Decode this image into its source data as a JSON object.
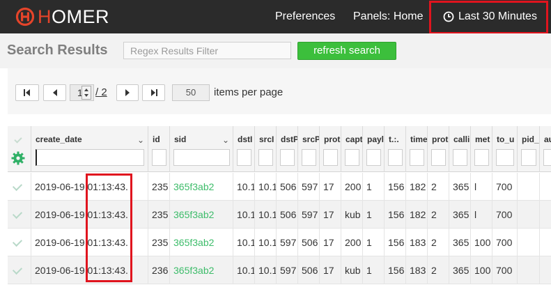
{
  "navbar": {
    "logo_h": "H",
    "logo_rest": "OMER",
    "preferences": "Preferences",
    "panels": "Panels: Home",
    "time_range": "Last 30 Minutes"
  },
  "search": {
    "title": "Search Results",
    "filter_placeholder": "Regex Results Filter",
    "refresh_label": "refresh search"
  },
  "pager": {
    "current_page": "1",
    "total_pages": "/ 2",
    "per_page": "50",
    "per_page_label": "items per page"
  },
  "grid": {
    "columns": [
      "create_date",
      "id",
      "sid",
      "dstIp",
      "srcIp",
      "dstPort",
      "srcPort",
      "protocol",
      "capture",
      "payload",
      "type",
      "time",
      "proto",
      "callid",
      "method",
      "to_user",
      "pid_user",
      "auth"
    ],
    "column_display": [
      "create_date",
      "id",
      "sid",
      "dstI",
      "srcI",
      "dstP",
      "srcP",
      "prot",
      "capt",
      "payl",
      "t.:.",
      "time",
      "prot",
      "calli",
      "met",
      "to_u",
      "pid_",
      "auth"
    ],
    "rows": [
      [
        "2019-06-19 01:13:43.",
        "235",
        "365f3ab2",
        "10.1",
        "10.1",
        "506",
        "597",
        "17",
        "200",
        "1",
        "156",
        "182",
        "2",
        "365",
        "l",
        "700",
        "",
        ""
      ],
      [
        "2019-06-19 01:13:43.",
        "235",
        "365f3ab2",
        "10.1",
        "10.1",
        "506",
        "597",
        "17",
        "kub",
        "1",
        "156",
        "182",
        "2",
        "365",
        "l",
        "700",
        "",
        ""
      ],
      [
        "2019-06-19 01:13:43.",
        "235",
        "365f3ab2",
        "10.1",
        "10.1",
        "597",
        "506",
        "17",
        "200",
        "1",
        "156",
        "183",
        "2",
        "365",
        "100",
        "700",
        "",
        ""
      ],
      [
        "2019-06-19 01:13:43.",
        "236",
        "365f3ab2",
        "10.1",
        "10.1",
        "597",
        "506",
        "17",
        "kub",
        "1",
        "156",
        "183",
        "2",
        "365",
        "100",
        "700",
        "",
        ""
      ]
    ]
  },
  "colors": {
    "navbar_bg": "#2b2b2b",
    "accent_red": "#e5442a",
    "refresh_green": "#3cbf3c",
    "sid_green": "#3dbc6a",
    "highlight_red": "#e0141e"
  },
  "icons": [
    "homer-logo-icon",
    "clock-icon",
    "first-page-icon",
    "prev-page-icon",
    "next-page-icon",
    "last-page-icon",
    "gear-icon",
    "checkmark-icon",
    "chevron-down-icon"
  ]
}
